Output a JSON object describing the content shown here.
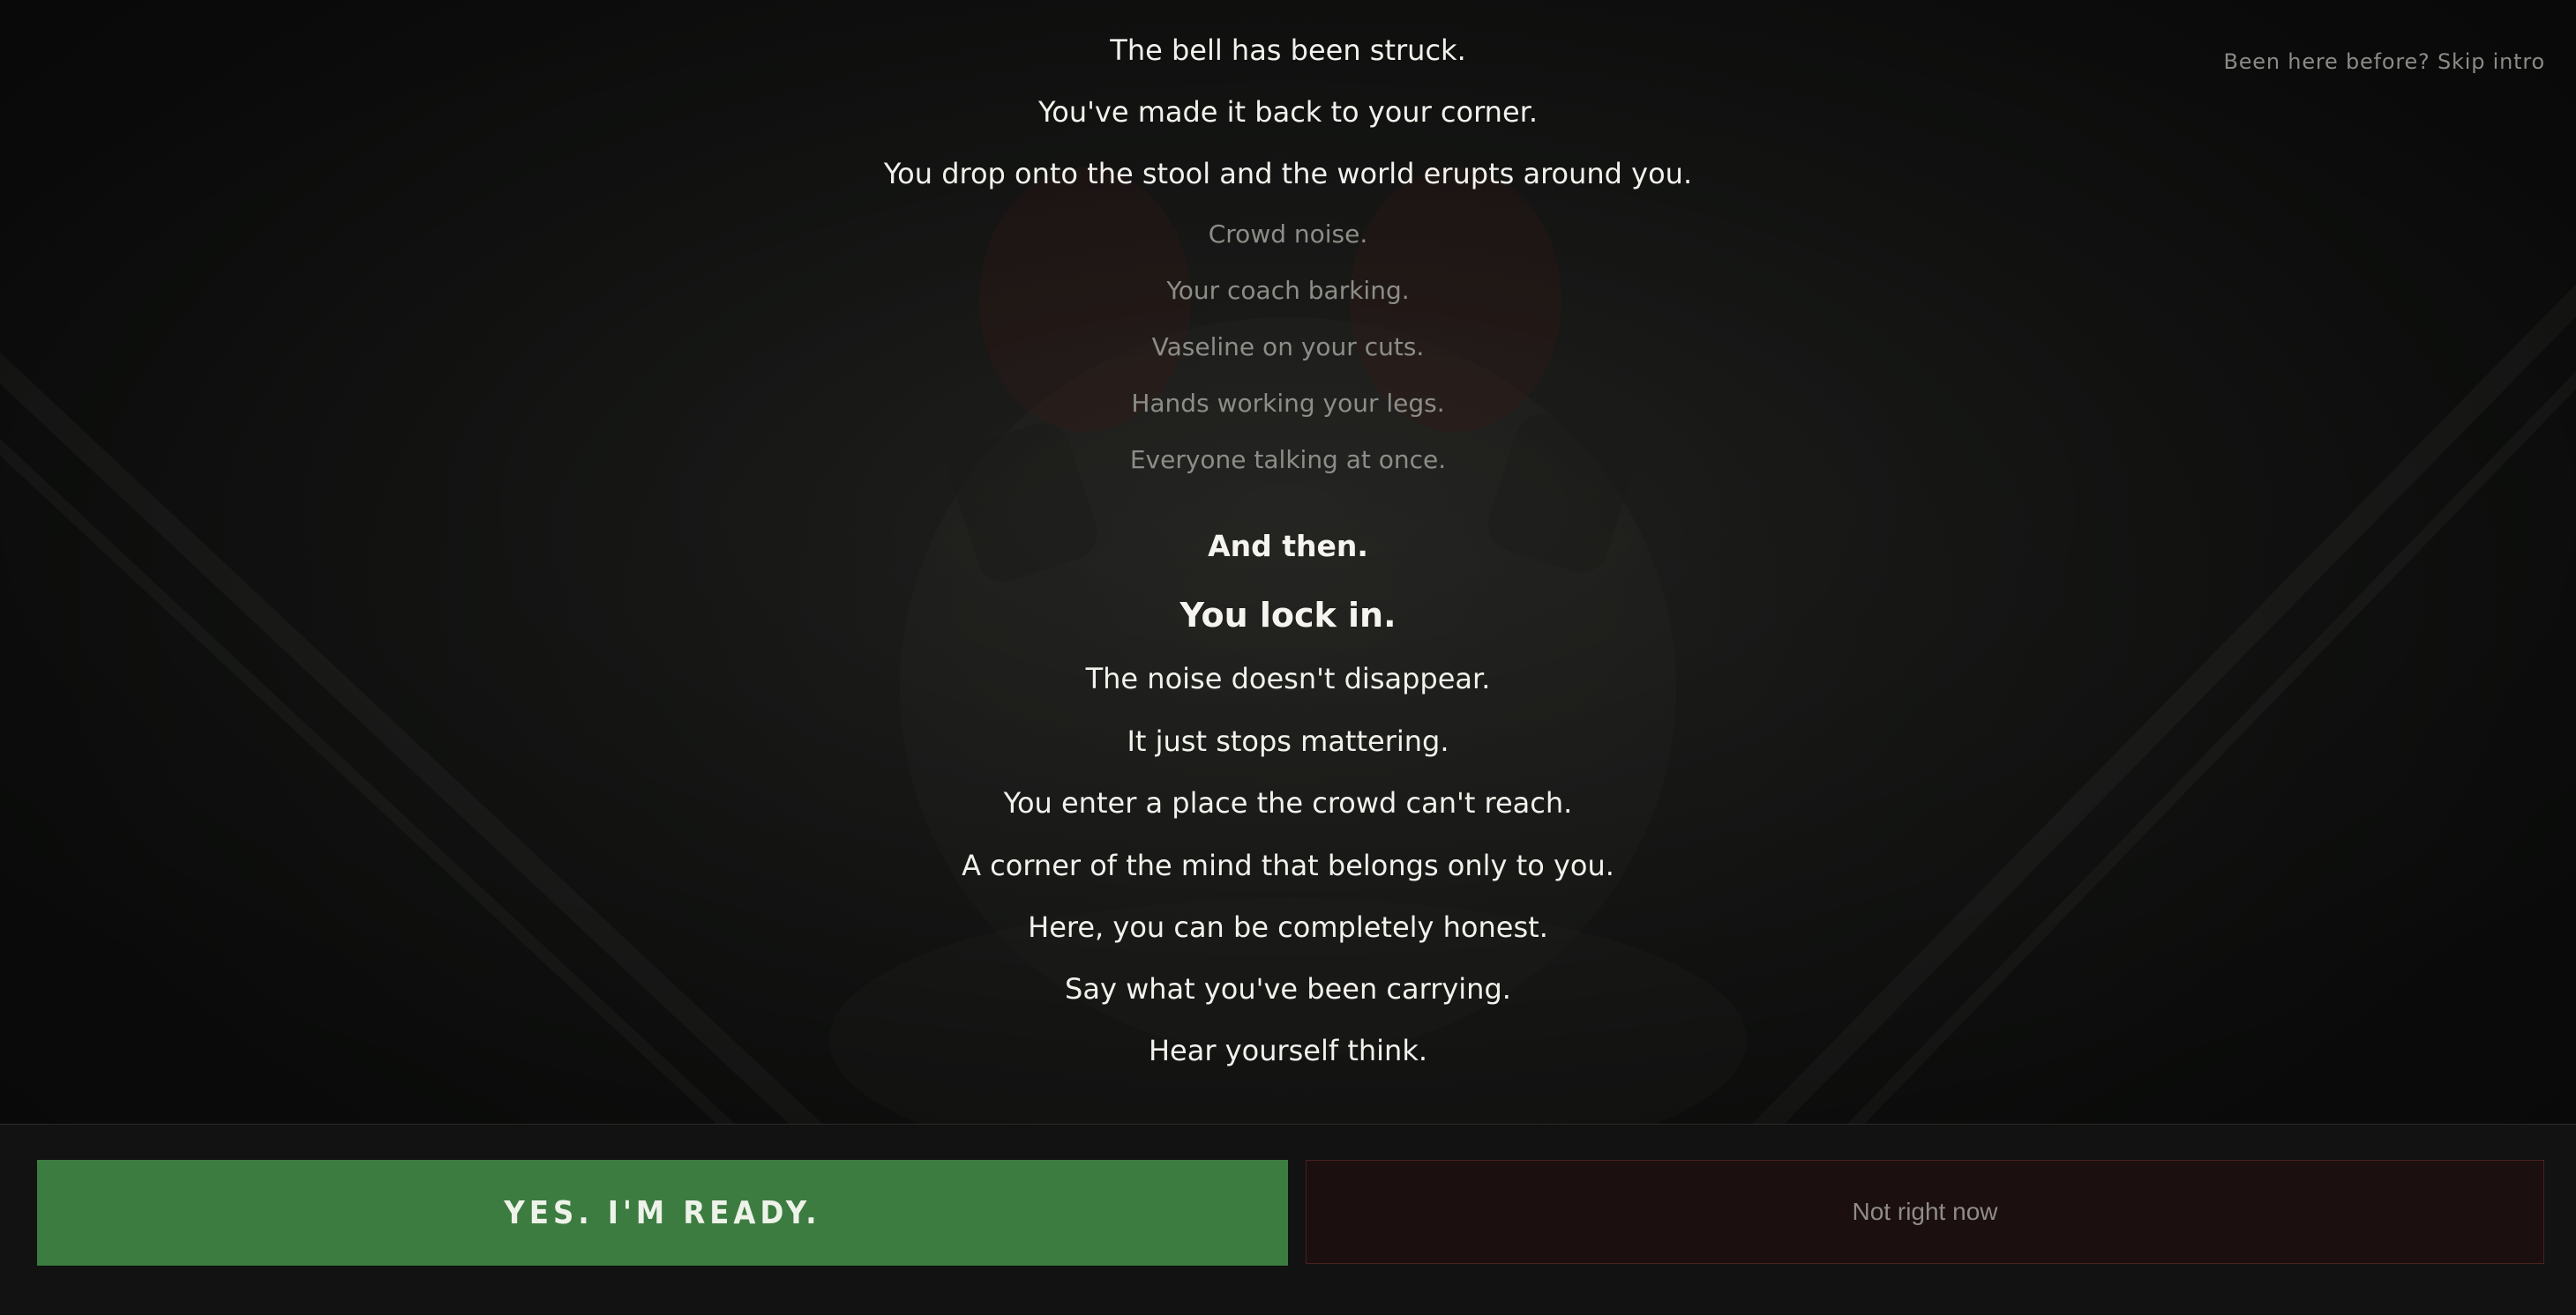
{
  "header": {
    "skip_label": "Been here before? Skip intro"
  },
  "story": {
    "lines": [
      {
        "text": "The bell has been struck.",
        "style": "main"
      },
      {
        "text": "You've made it back to your corner.",
        "style": "main"
      },
      {
        "text": "You drop onto the stool and the world erupts around you.",
        "style": "main"
      },
      {
        "text": "Crowd noise.",
        "style": "dim"
      },
      {
        "text": "Your coach barking.",
        "style": "dim"
      },
      {
        "text": "Vaseline on your cuts.",
        "style": "dim"
      },
      {
        "text": "Hands working your legs.",
        "style": "dim"
      },
      {
        "text": "Everyone talking at once.",
        "style": "dim"
      },
      {
        "text": "And then.",
        "style": "bold"
      },
      {
        "text": "You lock in.",
        "style": "bold-large"
      },
      {
        "text": "The noise doesn't disappear.",
        "style": "main"
      },
      {
        "text": "It just stops mattering.",
        "style": "main"
      },
      {
        "text": "You enter a place the crowd can't reach.",
        "style": "main"
      },
      {
        "text": "A corner of the mind that belongs only to you.",
        "style": "main"
      },
      {
        "text": "Here, you can be completely honest.",
        "style": "main"
      },
      {
        "text": "Say what you've been carrying.",
        "style": "main"
      },
      {
        "text": "Hear yourself think.",
        "style": "main"
      }
    ]
  },
  "actions": {
    "ready_label": "YES. I'M READY.",
    "decline_label": "Not right now"
  },
  "colors": {
    "background": "#121312",
    "ready_button": "#3d7c40",
    "decline_button": "#1b0f0f",
    "decline_border": "#4a2222",
    "text_primary": "#f2f1ec",
    "text_dim": "#8d8d88"
  }
}
